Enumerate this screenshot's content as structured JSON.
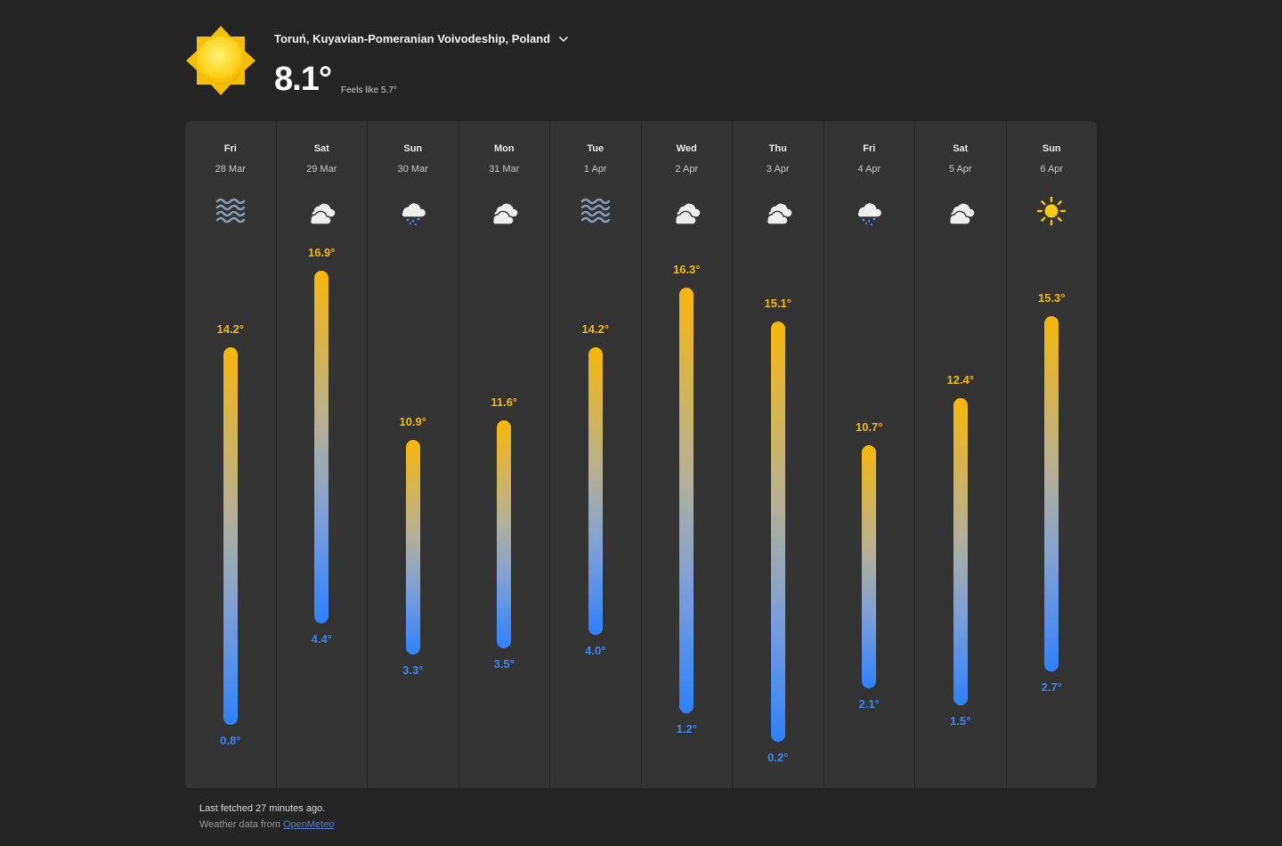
{
  "location": "Toruń, Kuyavian-Pomeranian Voivodeship, Poland",
  "current": {
    "temp": "8.1°",
    "feels_like": "Feels like 5.7°",
    "icon": "sun-icon"
  },
  "days": [
    {
      "dow": "Fri",
      "date": "28 Mar",
      "icon": "fog",
      "max": 14.2,
      "min": 0.8,
      "max_label": "14.2°",
      "min_label": "0.8°"
    },
    {
      "dow": "Sat",
      "date": "29 Mar",
      "icon": "cloud",
      "max": 16.9,
      "min": 4.4,
      "max_label": "16.9°",
      "min_label": "4.4°"
    },
    {
      "dow": "Sun",
      "date": "30 Mar",
      "icon": "rain",
      "max": 10.9,
      "min": 3.3,
      "max_label": "10.9°",
      "min_label": "3.3°"
    },
    {
      "dow": "Mon",
      "date": "31 Mar",
      "icon": "cloud",
      "max": 11.6,
      "min": 3.5,
      "max_label": "11.6°",
      "min_label": "3.5°"
    },
    {
      "dow": "Tue",
      "date": "1 Apr",
      "icon": "fog",
      "max": 14.2,
      "min": 4.0,
      "max_label": "14.2°",
      "min_label": "4.0°"
    },
    {
      "dow": "Wed",
      "date": "2 Apr",
      "icon": "cloud",
      "max": 16.3,
      "min": 1.2,
      "max_label": "16.3°",
      "min_label": "1.2°"
    },
    {
      "dow": "Thu",
      "date": "3 Apr",
      "icon": "cloud",
      "max": 15.1,
      "min": 0.2,
      "max_label": "15.1°",
      "min_label": "0.2°"
    },
    {
      "dow": "Fri",
      "date": "4 Apr",
      "icon": "rain",
      "max": 10.7,
      "min": 2.1,
      "max_label": "10.7°",
      "min_label": "2.1°"
    },
    {
      "dow": "Sat",
      "date": "5 Apr",
      "icon": "cloud",
      "max": 12.4,
      "min": 1.5,
      "max_label": "12.4°",
      "min_label": "1.5°"
    },
    {
      "dow": "Sun",
      "date": "6 Apr",
      "icon": "sun",
      "max": 15.3,
      "min": 2.7,
      "max_label": "15.3°",
      "min_label": "2.7°"
    }
  ],
  "footer": {
    "fetched": "Last fetched 27 minutes ago.",
    "source_prefix": "Weather data from ",
    "source_link": "OpenMeteo"
  },
  "colors": {
    "high": "#f5b814",
    "low": "#3d84f5",
    "panel": "#333333",
    "background": "#242424"
  }
}
